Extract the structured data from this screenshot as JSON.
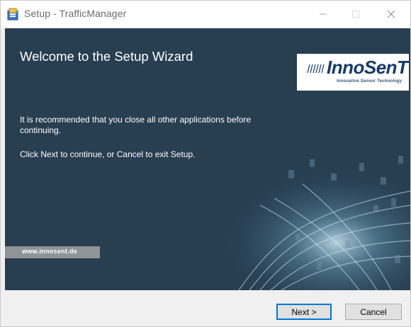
{
  "window": {
    "title": "Setup - TrafficManager",
    "controls": {
      "minimize_icon": "minimize-icon",
      "maximize_icon": "maximize-icon",
      "close_icon": "close-icon"
    }
  },
  "wizard": {
    "heading": "Welcome to the Setup Wizard",
    "paragraph1": "It is recommended that you close all other applications before continuing.",
    "paragraph2": "Click Next to continue, or Cancel to exit Setup.",
    "website": "www.innosent.de",
    "logo": {
      "name": "InnoSenT",
      "tagline": "Innovative Sensor Technology"
    }
  },
  "buttons": {
    "next": "Next >",
    "cancel": "Cancel"
  },
  "colors": {
    "panel_background": "#283e51",
    "accent": "#0078d7",
    "logo_text": "#163a6b"
  }
}
